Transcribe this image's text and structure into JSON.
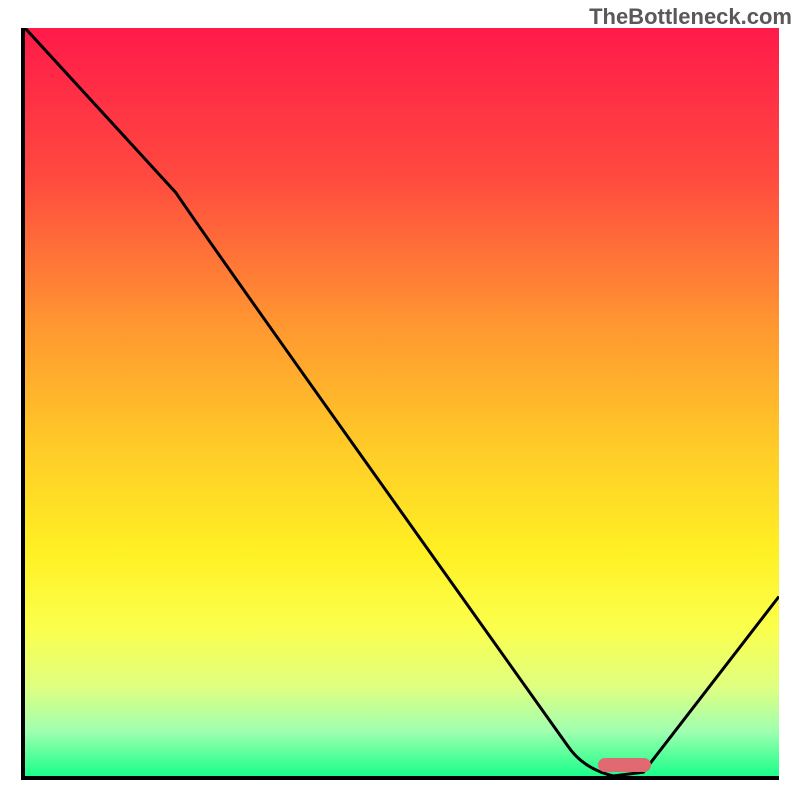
{
  "watermark": "TheBottleneck.com",
  "chart_data": {
    "type": "line",
    "title": "",
    "xlabel": "",
    "ylabel": "",
    "xlim": [
      0,
      100
    ],
    "ylim": [
      0,
      100
    ],
    "gradient_stops": [
      {
        "offset": 0,
        "color": "#ff1a4a"
      },
      {
        "offset": 20,
        "color": "#ff4a3f"
      },
      {
        "offset": 40,
        "color": "#ff9830"
      },
      {
        "offset": 55,
        "color": "#ffc828"
      },
      {
        "offset": 70,
        "color": "#fff024"
      },
      {
        "offset": 80,
        "color": "#fbff4b"
      },
      {
        "offset": 88,
        "color": "#e0ff80"
      },
      {
        "offset": 94,
        "color": "#a0ffb0"
      },
      {
        "offset": 100,
        "color": "#1aff8a"
      }
    ],
    "curve_points": [
      {
        "x": 0,
        "y": 100
      },
      {
        "x": 20,
        "y": 78
      },
      {
        "x": 24,
        "y": 72
      },
      {
        "x": 72,
        "y": 4
      },
      {
        "x": 74,
        "y": 1
      },
      {
        "x": 78,
        "y": 0
      },
      {
        "x": 82,
        "y": 0.5
      },
      {
        "x": 100,
        "y": 24
      }
    ],
    "marker": {
      "x_start": 76,
      "x_end": 83,
      "y": 1.5
    }
  }
}
